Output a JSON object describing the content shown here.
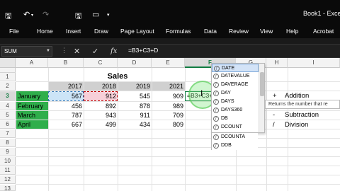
{
  "titlebar": {
    "doc_title": "Book1 - Exce",
    "qa": {
      "save": "🖫",
      "undo": "↶",
      "redo": "↷",
      "save2": "🖫",
      "layout": "▭"
    }
  },
  "ribbon": {
    "tabs": [
      "File",
      "Home",
      "Insert",
      "Draw",
      "Page Layout",
      "Formulas",
      "Data",
      "Review",
      "View",
      "Help",
      "Acrobat"
    ]
  },
  "formula_bar": {
    "name_box": "SUM",
    "cancel": "✕",
    "enter": "✓",
    "fx": "fx",
    "formula": "=B3+C3+D"
  },
  "grid": {
    "columns": [
      "A",
      "B",
      "C",
      "D",
      "E",
      "F",
      "G",
      "H",
      "I"
    ],
    "rows": [
      "1",
      "2",
      "3",
      "4",
      "5",
      "6",
      "7",
      "8",
      "9",
      "10",
      "11",
      "12",
      "13",
      "14"
    ],
    "title": "Sales",
    "years": [
      "2017",
      "2018",
      "2019",
      "2021"
    ],
    "months": [
      "January",
      "February",
      "March",
      "April"
    ],
    "values": [
      [
        "567",
        "912",
        "545",
        "909"
      ],
      [
        "456",
        "892",
        "878",
        "989"
      ],
      [
        "787",
        "943",
        "911",
        "709"
      ],
      [
        "667",
        "499",
        "434",
        "809"
      ]
    ],
    "active_cell_text": "=B3+C3+D"
  },
  "legend": [
    {
      "op": "+",
      "label": "Addition"
    },
    {
      "op": "-",
      "label": "Subtraction"
    },
    {
      "op": "/",
      "label": "Division"
    }
  ],
  "autocomplete": {
    "items": [
      "DATE",
      "DATEVALUE",
      "DAVERAGE",
      "DAY",
      "DAYS",
      "DAYS360",
      "DB",
      "DCOUNT",
      "DCOUNTA",
      "DDB"
    ],
    "selected": "DATE",
    "tooltip": "Returns the number that re"
  }
}
